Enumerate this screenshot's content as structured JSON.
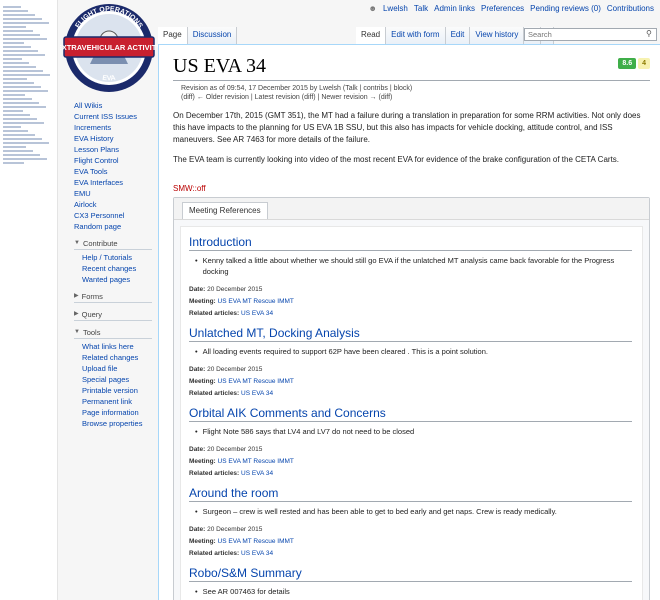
{
  "personal": {
    "username": "Lwelsh",
    "talk": "Talk",
    "admin_links": "Admin links",
    "preferences": "Preferences",
    "pending_reviews": "Pending reviews (0)",
    "contributions": "Contributions"
  },
  "logo": {
    "top_text": "FLIGHT OPERATIONS",
    "banner": "EXTRAVEHICULAR ACTIVITY",
    "bottom_text": "EVA"
  },
  "tabs": {
    "page": "Page",
    "discussion": "Discussion",
    "read": "Read",
    "edit_with_form": "Edit with form",
    "edit": "Edit",
    "view_history": "View history",
    "star": "★",
    "more": "▾"
  },
  "search": {
    "placeholder": "Search"
  },
  "sidebar": {
    "main": [
      "All Wikis",
      "Current ISS Issues",
      "Increments",
      "EVA History",
      "Lesson Plans",
      "Flight Control",
      "EVA Tools",
      "EVA Interfaces",
      "EMU",
      "Airlock",
      "CX3 Personnel",
      "Random page"
    ],
    "contribute": {
      "title": "Contribute",
      "items": [
        "Help / Tutorials",
        "Recent changes",
        "Wanted pages"
      ]
    },
    "forms": {
      "title": "Forms"
    },
    "query": {
      "title": "Query"
    },
    "tools": {
      "title": "Tools",
      "items": [
        "What links here",
        "Related changes",
        "Upload file",
        "Special pages",
        "Printable version",
        "Permanent link",
        "Page information",
        "Browse properties"
      ]
    }
  },
  "page": {
    "title": "US EVA 34",
    "badge_green": "8.6",
    "badge_yellow": "4",
    "revision_line1": "Revision as of 09:54, 17 December 2015 by Lwelsh (Talk | contribs | block)",
    "revision_line2": "(diff) ← Older revision | Latest revision (diff) | Newer revision → (diff)",
    "para1": "On December 17th, 2015 (GMT 351), the MT had a failure during a translation in preparation for some RRM activities. Not only does this have impacts to the planning for US EVA 1B SSU, but this also has impacts for vehicle docking, attitude control, and ISS maneuvers. See AR 7463 for more details of the failure.",
    "para2": "The EVA team is currently looking into video of the most recent EVA for evidence of the brake configuration of the CETA Carts.",
    "smw": "SMW::off"
  },
  "meeting": {
    "tab_label": "Meeting References",
    "date_label": "Date:",
    "meeting_label": "Meeting:",
    "related_label": "Related articles:",
    "sections": [
      {
        "heading": "Introduction",
        "bullet": "Kenny talked a little about whether we should still go EVA if the unlatched MT analysis came back favorable for the Progress docking",
        "date": "20 December 2015",
        "meeting": "US EVA MT Rescue IMMT",
        "related": "US EVA 34"
      },
      {
        "heading": "Unlatched MT, Docking Analysis",
        "bullet": "All loading events required to support 62P have been cleared . This is a point solution.",
        "date": "20 December 2015",
        "meeting": "US EVA MT Rescue IMMT",
        "related": "US EVA 34"
      },
      {
        "heading": "Orbital AIK Comments and Concerns",
        "bullet": "Flight Note 586 says that LV4 and LV7 do not need to be closed",
        "date": "20 December 2015",
        "meeting": "US EVA MT Rescue IMMT",
        "related": "US EVA 34"
      },
      {
        "heading": "Around the room",
        "bullet": "Surgeon – crew is well rested and has been able to get to bed early and get naps. Crew is ready medically.",
        "date": "20 December 2015",
        "meeting": "US EVA MT Rescue IMMT",
        "related": "US EVA 34"
      },
      {
        "heading": "Robo/S&M Summary",
        "bullet": "See AR 007463 for details"
      }
    ]
  },
  "colors": {
    "link": "#0645ad",
    "badge_green": "#3fae49",
    "badge_yellow": "#f7f2b0",
    "logo_red": "#c8202f",
    "logo_navy": "#1b2a6b"
  }
}
